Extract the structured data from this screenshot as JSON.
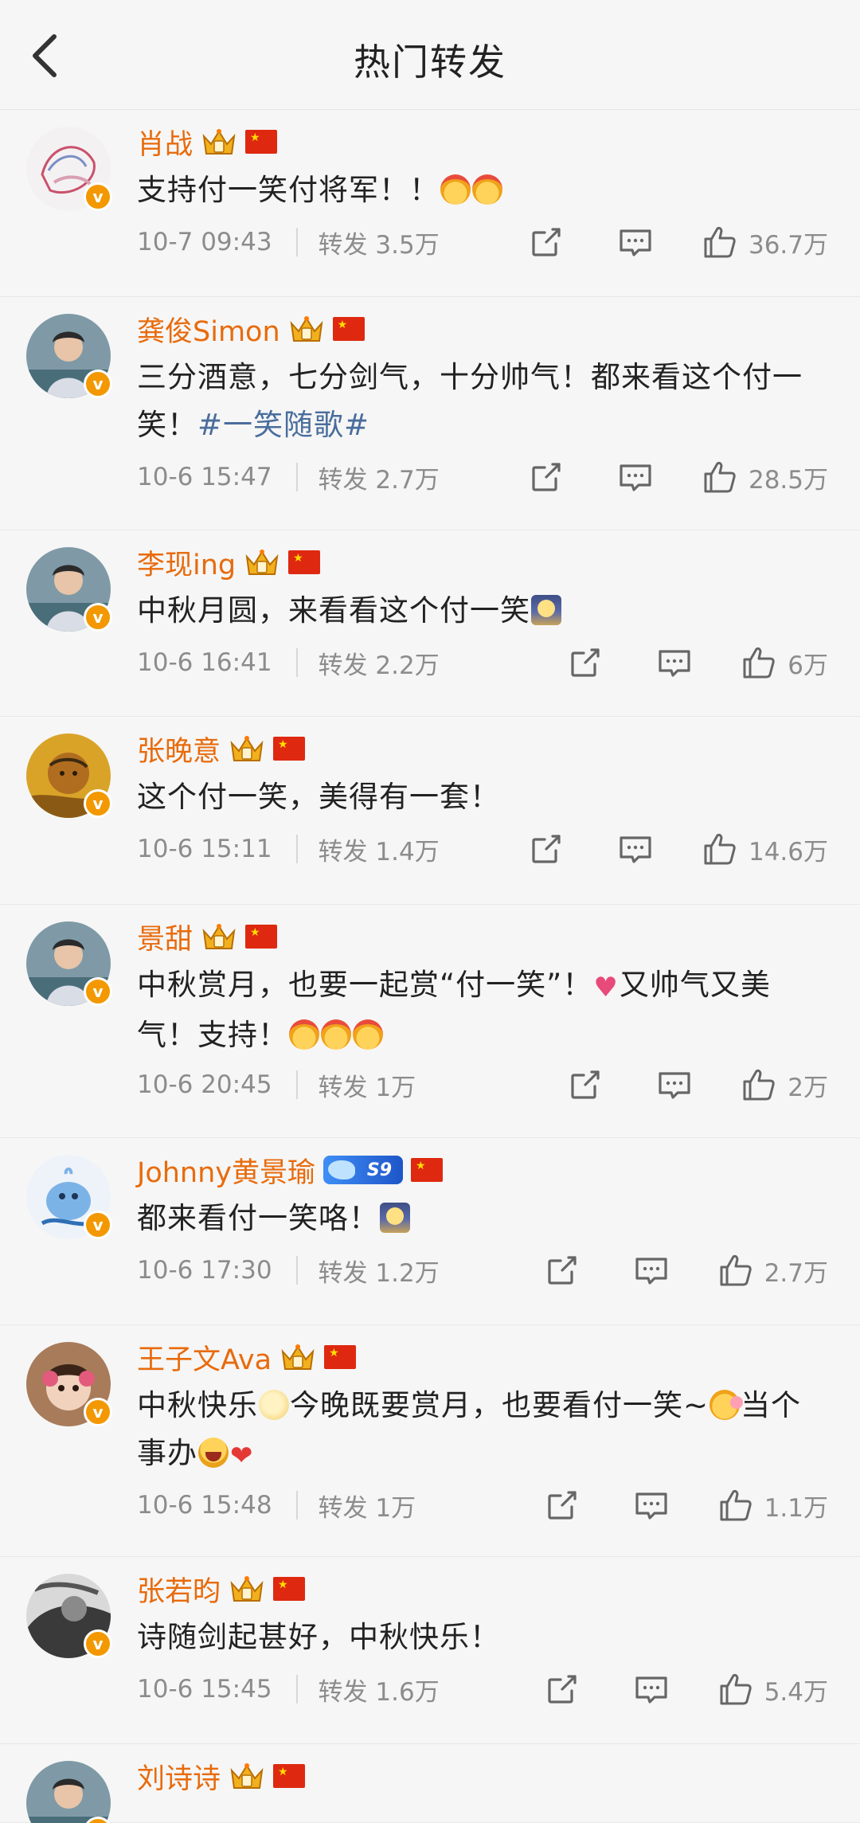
{
  "header": {
    "title": "热门转发"
  },
  "colors": {
    "name": "#e86b0c",
    "topic": "#4a6d9d",
    "meta": "#8c8c8c",
    "vip": "#f39800"
  },
  "items": [
    {
      "name": "肖战",
      "badge": "crown",
      "segments": [
        {
          "t": "text",
          "v": "支持付一笑付将军！！"
        },
        {
          "t": "emo",
          "icon": "cheer-emoji"
        },
        {
          "t": "emo",
          "icon": "cheer-emoji"
        }
      ],
      "time": "10-7 09:43",
      "repost": "转发 3.5万",
      "likes": "36.7万",
      "avatar_icon": "avatar-sketch"
    },
    {
      "name": "龚俊Simon",
      "badge": "crown",
      "segments": [
        {
          "t": "text",
          "v": "三分酒意，七分剑气，十分帅气！都来看这个付一笑！"
        },
        {
          "t": "topic",
          "v": "#一笑随歌#"
        }
      ],
      "time": "10-6 15:47",
      "repost": "转发 2.7万",
      "likes": "28.5万",
      "avatar_icon": "avatar-person"
    },
    {
      "name": "李现ing",
      "badge": "crown",
      "segments": [
        {
          "t": "text",
          "v": "中秋月圆，来看看这个付一笑"
        },
        {
          "t": "emo",
          "icon": "moon-emoji"
        }
      ],
      "time": "10-6 16:41",
      "repost": "转发 2.2万",
      "likes": "6万",
      "avatar_icon": "avatar-person"
    },
    {
      "name": "张晚意",
      "badge": "crown",
      "segments": [
        {
          "t": "text",
          "v": "这个付一笑，美得有一套！"
        }
      ],
      "time": "10-6 15:11",
      "repost": "转发 1.4万",
      "likes": "14.6万",
      "avatar_icon": "avatar-painting"
    },
    {
      "name": "景甜",
      "badge": "crown",
      "segments": [
        {
          "t": "text",
          "v": "中秋赏月，也要一起赏“付一笑”！"
        },
        {
          "t": "emo",
          "icon": "hearts-emoji"
        },
        {
          "t": "text",
          "v": "又帅气又美气！支持！"
        },
        {
          "t": "emo",
          "icon": "cheer-emoji"
        },
        {
          "t": "emo",
          "icon": "cheer-emoji"
        },
        {
          "t": "emo",
          "icon": "cheer-emoji"
        }
      ],
      "time": "10-6 20:45",
      "repost": "转发 1万",
      "likes": "2万",
      "avatar_icon": "avatar-person"
    },
    {
      "name": "Johnny黄景瑜",
      "badge": "level",
      "level": "S9",
      "segments": [
        {
          "t": "text",
          "v": "都来看付一笑咯！"
        },
        {
          "t": "emo",
          "icon": "moon-emoji"
        }
      ],
      "time": "10-6 17:30",
      "repost": "转发 1.2万",
      "likes": "2.7万",
      "avatar_icon": "avatar-whale"
    },
    {
      "name": "王子文Ava",
      "badge": "crown",
      "segments": [
        {
          "t": "text",
          "v": "中秋快乐"
        },
        {
          "t": "emo",
          "icon": "full-moon-emoji"
        },
        {
          "t": "text",
          "v": "今晚既要赏月，也要看付一笑~"
        },
        {
          "t": "emo",
          "icon": "blush-emoji"
        },
        {
          "t": "text",
          "v": "当个事办"
        },
        {
          "t": "emo",
          "icon": "laugh-emoji"
        },
        {
          "t": "emo",
          "icon": "red-heart-emoji"
        }
      ],
      "time": "10-6 15:48",
      "repost": "转发 1万",
      "likes": "1.1万",
      "avatar_icon": "avatar-child"
    },
    {
      "name": "张若昀",
      "badge": "crown",
      "segments": [
        {
          "t": "text",
          "v": "诗随剑起甚好，中秋快乐！"
        }
      ],
      "time": "10-6 15:45",
      "repost": "转发 1.6万",
      "likes": "5.4万",
      "avatar_icon": "avatar-bw"
    },
    {
      "name": "刘诗诗",
      "badge": "crown",
      "segments": [],
      "time": "",
      "repost": "",
      "likes": "",
      "avatar_icon": "avatar-person"
    }
  ]
}
